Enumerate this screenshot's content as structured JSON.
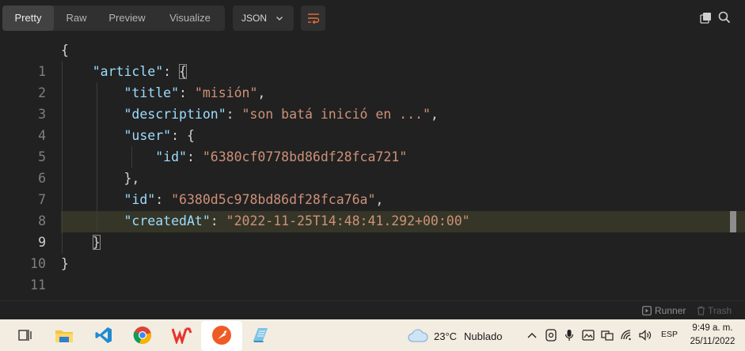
{
  "toolbar": {
    "tabs": [
      {
        "label": "Pretty",
        "active": true
      },
      {
        "label": "Raw",
        "active": false
      },
      {
        "label": "Preview",
        "active": false
      },
      {
        "label": "Visualize",
        "active": false
      }
    ],
    "format": "JSON",
    "wrap_icon": "wrap-lines-icon",
    "right_icons": [
      "copy-icon",
      "search-icon"
    ]
  },
  "editor": {
    "line_numbers": [
      "1",
      "2",
      "3",
      "4",
      "5",
      "6",
      "7",
      "8",
      "9",
      "10",
      "11"
    ],
    "active_line": 9,
    "tokens": {
      "open_brace": "{",
      "close_brace": "}",
      "key_article": "\"article\"",
      "key_title": "\"title\"",
      "val_title": "\"misión\"",
      "key_description": "\"description\"",
      "val_description": "\"son batá inició en ...\"",
      "key_user": "\"user\"",
      "key_user_id": "\"id\"",
      "val_user_id": "\"6380cf0778bd86df28fca721\"",
      "user_close": "},",
      "key_id": "\"id\"",
      "val_id": "\"6380d5c978bd86df28fca76a\"",
      "key_createdAt": "\"createdAt\"",
      "val_createdAt": "\"2022-11-25T14:48:41.292+00:00\"",
      "colon": ": ",
      "comma": ","
    }
  },
  "footer": {
    "runner_label": "Runner",
    "trash_label": "Trash"
  },
  "taskbar": {
    "apps": [
      "task-view-icon",
      "file-explorer-icon",
      "vscode-icon",
      "chrome-icon",
      "wps-office-icon",
      "postman-icon",
      "notes-icon"
    ],
    "weather_temp": "23°C",
    "weather_desc": "Nublado",
    "language": "ESP",
    "time": "9:49 a. m.",
    "date": "25/11/2022"
  },
  "colors": {
    "background": "#212121",
    "key": "#9cdcfe",
    "string": "#ce9178",
    "punctuation": "#d4d4d4",
    "taskbar": "#f3ece0",
    "postman_orange": "#ef5b25"
  }
}
